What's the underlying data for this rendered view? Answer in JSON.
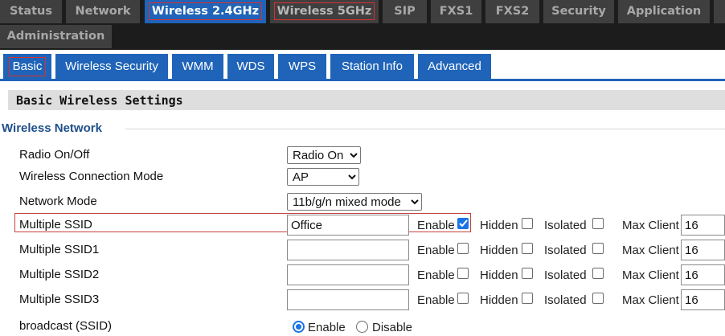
{
  "top_tabs": [
    {
      "label": "Status"
    },
    {
      "label": "Network"
    },
    {
      "label": "Wireless 2.4GHz",
      "active": true
    },
    {
      "label": "Wireless 5GHz"
    },
    {
      "label": "SIP"
    },
    {
      "label": "FXS1"
    },
    {
      "label": "FXS2"
    },
    {
      "label": "Security"
    },
    {
      "label": "Application"
    },
    {
      "label": "Administration"
    }
  ],
  "sub_tabs": [
    {
      "label": "Basic",
      "active": true
    },
    {
      "label": "Wireless Security"
    },
    {
      "label": "WMM"
    },
    {
      "label": "WDS"
    },
    {
      "label": "WPS"
    },
    {
      "label": "Station Info"
    },
    {
      "label": "Advanced"
    }
  ],
  "section_title": "Basic Wireless Settings",
  "legend": "Wireless Network",
  "fields": {
    "radio": {
      "label": "Radio On/Off",
      "value": "Radio On"
    },
    "connection_mode": {
      "label": "Wireless Connection Mode",
      "value": "AP"
    },
    "network_mode": {
      "label": "Network Mode",
      "value": "11b/g/n mixed mode"
    }
  },
  "ssids": [
    {
      "label": "Multiple SSID",
      "value": "Office",
      "enable": true,
      "hidden": false,
      "isolated": false,
      "max_client": "16"
    },
    {
      "label": "Multiple SSID1",
      "value": "",
      "enable": false,
      "hidden": false,
      "isolated": false,
      "max_client": "16"
    },
    {
      "label": "Multiple SSID2",
      "value": "",
      "enable": false,
      "hidden": false,
      "isolated": false,
      "max_client": "16"
    },
    {
      "label": "Multiple SSID3",
      "value": "",
      "enable": false,
      "hidden": false,
      "isolated": false,
      "max_client": "16"
    }
  ],
  "ssid_options": {
    "enable": "Enable",
    "hidden": "Hidden",
    "isolated": "Isolated",
    "max_client": "Max Client"
  },
  "broadcast": {
    "label": "broadcast (SSID)",
    "enable": "Enable",
    "disable": "Disable",
    "selected": "enable"
  },
  "colors": {
    "accent": "#1f64b8",
    "nav_bg": "#1c1c1c",
    "tab_bg": "#3f3f3f",
    "highlight": "#d83030"
  }
}
